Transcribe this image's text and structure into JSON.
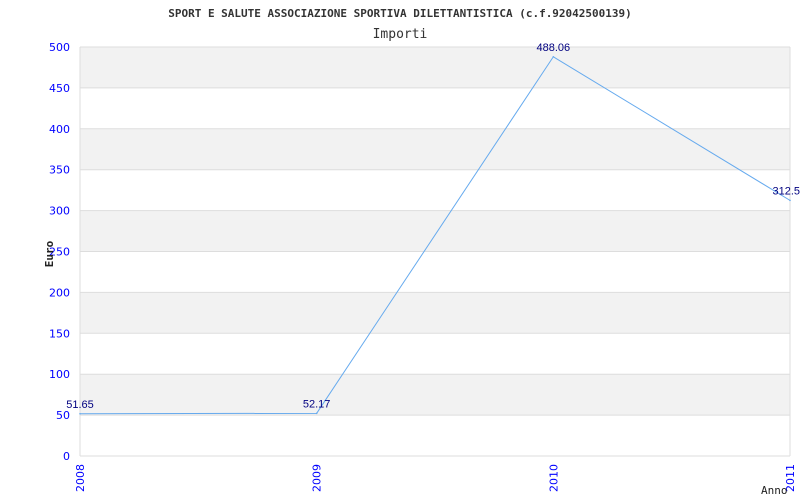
{
  "chart_data": {
    "type": "line",
    "title": "SPORT E SALUTE ASSOCIAZIONE SPORTIVA DILETTANTISTICA (c.f.92042500139)",
    "subtitle": "Importi",
    "xlabel": "Anno",
    "ylabel": "Euro",
    "categories": [
      "2008",
      "2009",
      "2010",
      "2011"
    ],
    "values": [
      51.65,
      52.17,
      488.06,
      312.5
    ],
    "data_labels": [
      "51.65",
      "52.17",
      "488.06",
      "312.5"
    ],
    "ylim": [
      0,
      500
    ],
    "yticks": [
      0,
      50,
      100,
      150,
      200,
      250,
      300,
      350,
      400,
      450,
      500
    ],
    "grid": true,
    "legend": "none",
    "colors": {
      "line": "#66aaee",
      "band": "#f2f2f2",
      "grid": "#dddddd",
      "tick": "#0000ff",
      "label": "#000080"
    }
  }
}
